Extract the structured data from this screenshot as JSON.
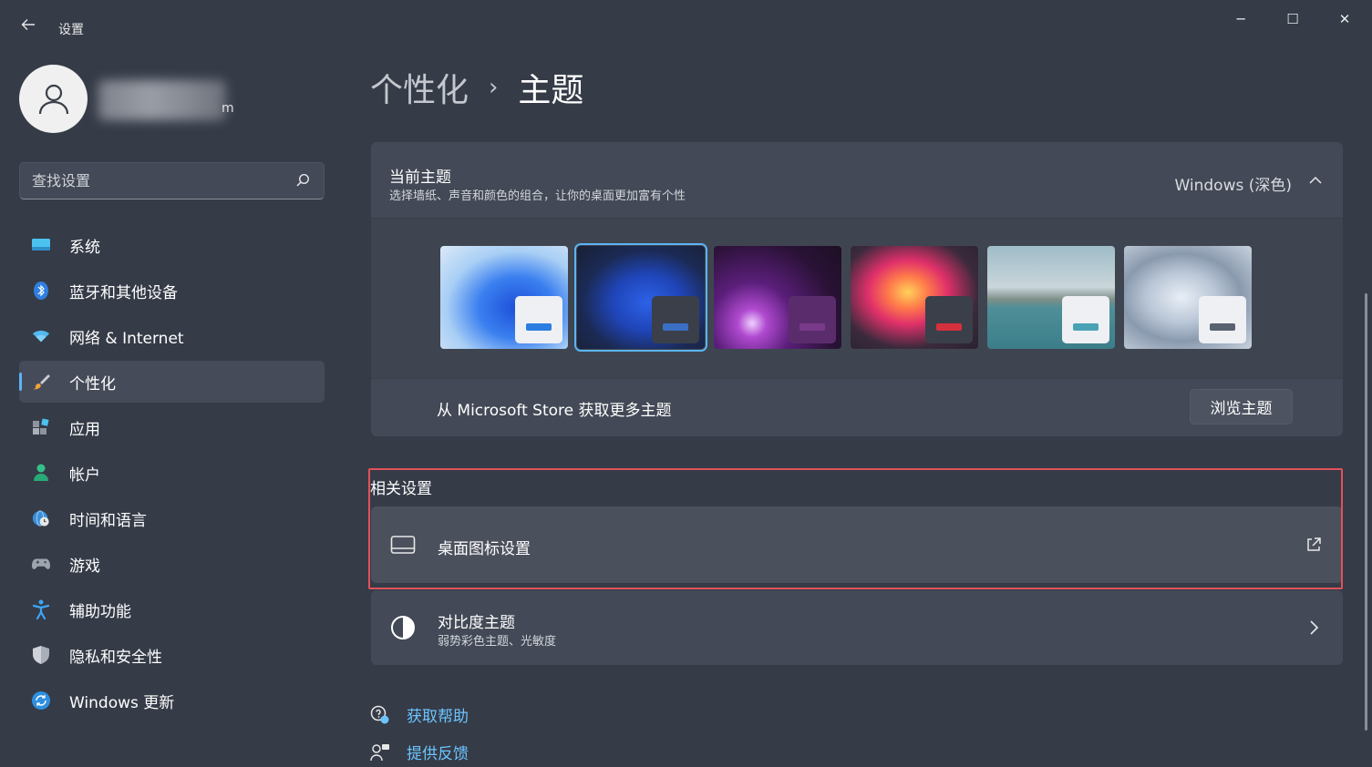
{
  "window": {
    "title": "设置",
    "controls": {
      "minimize": "─",
      "maximize": "☐",
      "close": "✕"
    }
  },
  "user": {
    "email_fragment": "m"
  },
  "search": {
    "placeholder": "查找设置"
  },
  "sidebar": {
    "items": [
      {
        "label": "系统",
        "icon": "monitor-icon"
      },
      {
        "label": "蓝牙和其他设备",
        "icon": "bluetooth-icon"
      },
      {
        "label": "网络 & Internet",
        "icon": "wifi-icon"
      },
      {
        "label": "个性化",
        "icon": "brush-icon",
        "active": true
      },
      {
        "label": "应用",
        "icon": "apps-icon"
      },
      {
        "label": "帐户",
        "icon": "person-icon"
      },
      {
        "label": "时间和语言",
        "icon": "globe-clock-icon"
      },
      {
        "label": "游戏",
        "icon": "gamepad-icon"
      },
      {
        "label": "辅助功能",
        "icon": "accessibility-icon"
      },
      {
        "label": "隐私和安全性",
        "icon": "shield-icon"
      },
      {
        "label": "Windows 更新",
        "icon": "update-icon"
      }
    ]
  },
  "breadcrumb": {
    "parent": "个性化",
    "separator": "›",
    "current": "主题"
  },
  "current_theme": {
    "title": "当前主题",
    "subtitle": "选择墙纸、声音和颜色的组合，让你的桌面更加富有个性",
    "value": "Windows (深色)",
    "selected_index": 1,
    "themes": [
      {
        "name": "windows-light",
        "accent": "#2b7de0"
      },
      {
        "name": "windows-dark",
        "accent": "#3a6fc4"
      },
      {
        "name": "glow",
        "accent": "#7a3a8a"
      },
      {
        "name": "captured-motion",
        "accent": "#d6303c"
      },
      {
        "name": "sunrise",
        "accent": "#4aa3b5"
      },
      {
        "name": "flow",
        "accent": "#5a6270"
      }
    ]
  },
  "store": {
    "label": "从 Microsoft Store 获取更多主题",
    "button": "浏览主题"
  },
  "related": {
    "title": "相关设置",
    "desktop_icons": {
      "label": "桌面图标设置"
    },
    "contrast": {
      "label": "对比度主题",
      "subtitle": "弱势彩色主题、光敏度"
    }
  },
  "help": {
    "get_help": "获取帮助",
    "feedback": "提供反馈"
  },
  "colors": {
    "accent": "#5bb4f5",
    "link": "#6cc4ff",
    "highlight": "#e0525a",
    "background": "#353b47",
    "card": "#434956"
  }
}
